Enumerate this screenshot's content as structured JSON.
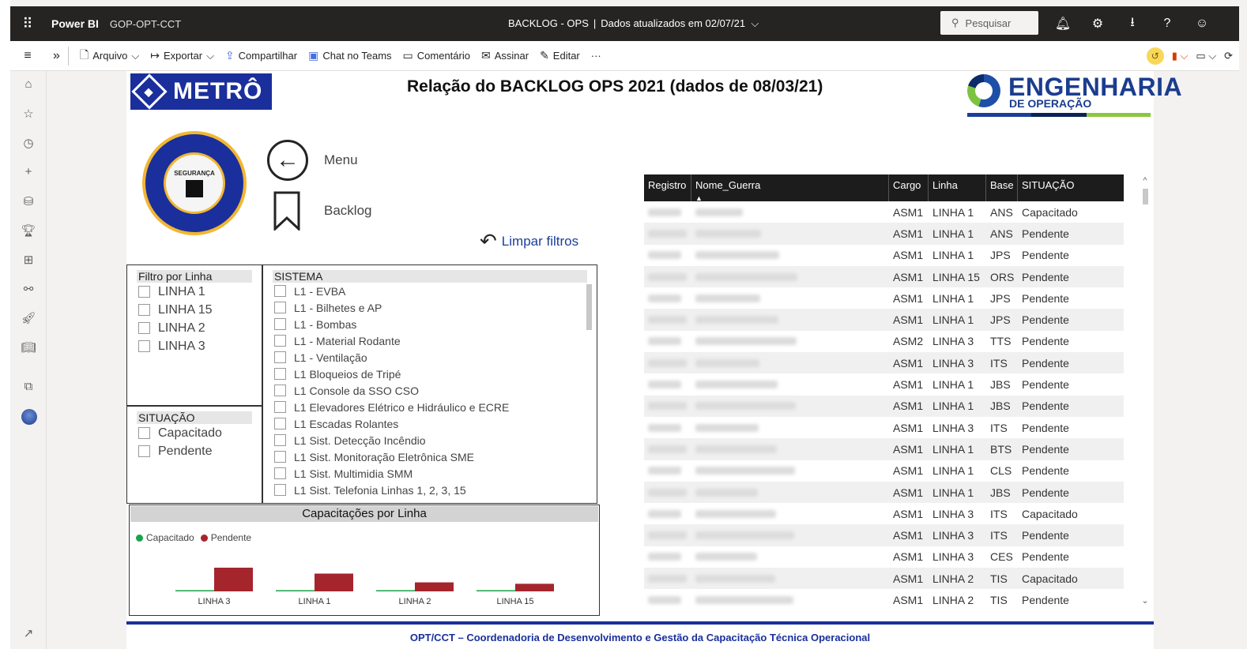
{
  "topbar": {
    "brand": "Power BI",
    "workspace": "GOP-OPT-CCT",
    "report_name": "BACKLOG - OPS",
    "updated": "Dados atualizados em 02/07/21",
    "search_placeholder": "Pesquisar"
  },
  "actions": {
    "arquivo": "Arquivo",
    "exportar": "Exportar",
    "compartilhar": "Compartilhar",
    "chat": "Chat no Teams",
    "comentario": "Comentário",
    "assinar": "Assinar",
    "editar": "Editar",
    "more": "···"
  },
  "report": {
    "metro_logo": "METRÔ",
    "title": "Relação do BACKLOG OPS 2021 (dados de 08/03/21)",
    "eng_logo_line1": "ENGENHARIA",
    "eng_logo_line2": "DE OPERAÇÃO",
    "seal_text": "SEGURANÇA",
    "menu_label": "Menu",
    "backlog_label": "Backlog",
    "clear_filters": "Limpar filtros",
    "footer": "OPT/CCT – Coordenadoria de Desenvolvimento e Gestão da Capacitação Técnica Operacional"
  },
  "slicer_linha": {
    "title": "Filtro por Linha",
    "options": [
      "LINHA 1",
      "LINHA 15",
      "LINHA 2",
      "LINHA 3"
    ]
  },
  "slicer_situacao": {
    "title": "SITUAÇÃO",
    "options": [
      "Capacitado",
      "Pendente"
    ]
  },
  "slicer_sistema": {
    "title": "SISTEMA",
    "options": [
      "L1 - EVBA",
      "L1 - Bilhetes e AP",
      "L1 - Bombas",
      "L1 - Material Rodante",
      "L1 - Ventilação",
      "L1 Bloqueios de Tripé",
      "L1 Console da SSO CSO",
      "L1 Elevadores Elétrico e Hidráulico e ECRE",
      "L1 Escadas Rolantes",
      "L1 Sist. Detecção Incêndio",
      "L1 Sist. Monitoração Eletrônica SME",
      "L1 Sist. Multimidia SMM",
      "L1 Sist. Telefonia Linhas 1, 2, 3, 15"
    ]
  },
  "chart_data": {
    "type": "bar",
    "title": "Capacitações por Linha",
    "categories": [
      "LINHA 3",
      "LINHA 1",
      "LINHA 2",
      "LINHA 15"
    ],
    "series": [
      {
        "name": "Capacitado",
        "color": "#1aa34a",
        "values": [
          0.02,
          0.02,
          0.02,
          0.02
        ]
      },
      {
        "name": "Pendente",
        "color": "#a4262c",
        "values": [
          1.0,
          0.75,
          0.38,
          0.32
        ]
      }
    ],
    "legend_position": "top-left"
  },
  "table": {
    "columns": [
      "Registro",
      "Nome_Guerra",
      "Cargo",
      "Linha",
      "Base",
      "SITUAÇÃO"
    ],
    "rows": [
      [
        "ASM1",
        "LINHA 1",
        "ANS",
        "Capacitado"
      ],
      [
        "ASM1",
        "LINHA 1",
        "ANS",
        "Pendente"
      ],
      [
        "ASM1",
        "LINHA 1",
        "JPS",
        "Pendente"
      ],
      [
        "ASM1",
        "LINHA 15",
        "ORS",
        "Pendente"
      ],
      [
        "ASM1",
        "LINHA 1",
        "JPS",
        "Pendente"
      ],
      [
        "ASM1",
        "LINHA 1",
        "JPS",
        "Pendente"
      ],
      [
        "ASM2",
        "LINHA 3",
        "TTS",
        "Pendente"
      ],
      [
        "ASM1",
        "LINHA 3",
        "ITS",
        "Pendente"
      ],
      [
        "ASM1",
        "LINHA 1",
        "JBS",
        "Pendente"
      ],
      [
        "ASM1",
        "LINHA 1",
        "JBS",
        "Pendente"
      ],
      [
        "ASM1",
        "LINHA 3",
        "ITS",
        "Pendente"
      ],
      [
        "ASM1",
        "LINHA 1",
        "BTS",
        "Pendente"
      ],
      [
        "ASM1",
        "LINHA 1",
        "CLS",
        "Pendente"
      ],
      [
        "ASM1",
        "LINHA 1",
        "JBS",
        "Pendente"
      ],
      [
        "ASM1",
        "LINHA 3",
        "ITS",
        "Capacitado"
      ],
      [
        "ASM1",
        "LINHA 3",
        "ITS",
        "Pendente"
      ],
      [
        "ASM1",
        "LINHA 3",
        "CES",
        "Pendente"
      ],
      [
        "ASM1",
        "LINHA 2",
        "TIS",
        "Capacitado"
      ],
      [
        "ASM1",
        "LINHA 2",
        "TIS",
        "Pendente"
      ]
    ]
  }
}
